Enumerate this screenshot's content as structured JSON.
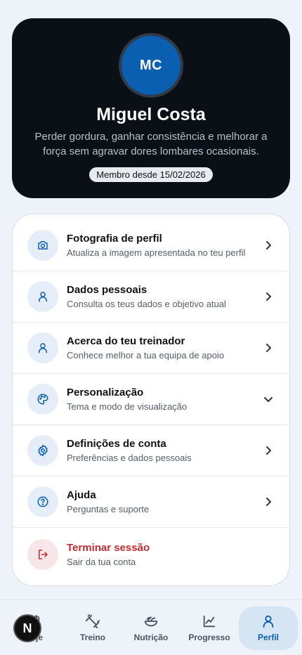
{
  "profile": {
    "initials": "MC",
    "name": "Miguel Costa",
    "bio": "Perder gordura, ganhar consistência e melhorar a força sem agravar dores lombares ocasionais.",
    "member_since": "Membro desde 15/02/2026"
  },
  "menu": {
    "items": [
      {
        "title": "Fotografia de perfil",
        "subtitle": "Atualiza a imagem apresentada no teu perfil",
        "icon": "camera-icon",
        "chevron": "chevron-right"
      },
      {
        "title": "Dados pessoais",
        "subtitle": "Consulta os teus dados e objetivo atual",
        "icon": "user-icon",
        "chevron": "chevron-right"
      },
      {
        "title": "Acerca do teu treinador",
        "subtitle": "Conhece melhor a tua equipa de apoio",
        "icon": "user-icon",
        "chevron": "chevron-right"
      },
      {
        "title": "Personalização",
        "subtitle": "Tema e modo de visualização",
        "icon": "palette-icon",
        "chevron": "chevron-down"
      },
      {
        "title": "Definições de conta",
        "subtitle": "Preferências e dados pessoais",
        "icon": "gear-icon",
        "chevron": "chevron-right"
      },
      {
        "title": "Ajuda",
        "subtitle": "Perguntas e suporte",
        "icon": "help-icon",
        "chevron": "chevron-right"
      },
      {
        "title": "Terminar sessão",
        "subtitle": "Sair da tua conta",
        "icon": "logout-icon",
        "chevron": ""
      }
    ]
  },
  "nav": {
    "tabs": [
      {
        "label": "Hoje",
        "icon": "calendar-icon"
      },
      {
        "label": "Treino",
        "icon": "dumbbell-icon"
      },
      {
        "label": "Nutrição",
        "icon": "salad-icon"
      },
      {
        "label": "Progresso",
        "icon": "chart-icon"
      },
      {
        "label": "Perfil",
        "icon": "user-icon",
        "active": true
      }
    ]
  },
  "fab": {
    "label": "N"
  },
  "colors": {
    "accent": "#0a5fb0",
    "danger": "#c62a2f",
    "hero_bg": "#0b0f16",
    "page_bg": "#eef3fa"
  }
}
